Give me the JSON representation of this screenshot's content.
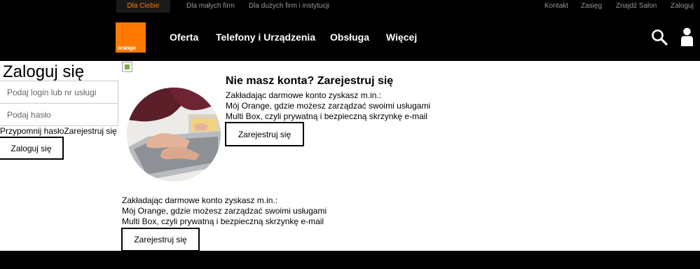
{
  "topbar": {
    "segments": [
      "Dla Ciebie",
      "Dla małych firm",
      "Dla dużych firm i instytucji"
    ],
    "utility_links": [
      "Kontakt",
      "Zasięg",
      "Znajdź Salon",
      "Zaloguj"
    ]
  },
  "header": {
    "logo_text": "orange",
    "nav": [
      "Oferta",
      "Telefony i Urządzenia",
      "Obsługa",
      "Więcej"
    ],
    "icons": [
      "search-icon",
      "user-icon"
    ]
  },
  "colors": {
    "brand": "#ff7900",
    "header_bg": "#000000",
    "content_bg": "#ffffff",
    "nav_text": "#ffffff",
    "topbar_text": "#999999"
  },
  "login": {
    "title": "Zaloguj się",
    "login_placeholder": "Podaj login lub nr usługi",
    "password_placeholder": "Podaj hasło",
    "remind_link": "Przypomnij hasło",
    "register_link": "Zarejestruj się",
    "submit_label": "Zaloguj się"
  },
  "register": {
    "title": "Nie masz konta? Zarejestruj się",
    "intro": "Zakładając darmowe konto zyskasz m.in.:",
    "benefit_1": "Mój Orange, gdzie możesz zarządzać swoimi usługami",
    "benefit_2": "Multi Box, czyli prywatną i bezpieczną skrzynkę e-mail",
    "button_label": "Zarejestruj się"
  },
  "register_repeat": {
    "intro": "Zakładając darmowe konto zyskasz m.in.:",
    "benefit_1": "Mój Orange, gdzie możesz zarządzać swoimi usługami",
    "benefit_2": "Multi Box, czyli prywatną i bezpieczną skrzynkę e-mail",
    "button_label": "Zarejestruj się"
  }
}
